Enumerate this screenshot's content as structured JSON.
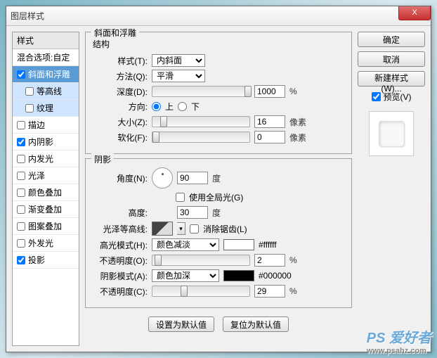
{
  "window": {
    "title": "图层样式",
    "close": "X"
  },
  "sidebar": {
    "header": "样式",
    "blend": "混合选项:自定",
    "items": [
      {
        "label": "斜面和浮雕",
        "checked": true,
        "sel": "blue"
      },
      {
        "label": "等高线",
        "checked": false,
        "sub": true,
        "sel": "light"
      },
      {
        "label": "纹理",
        "checked": false,
        "sub": true,
        "sel": "light"
      },
      {
        "label": "描边",
        "checked": false
      },
      {
        "label": "内阴影",
        "checked": true
      },
      {
        "label": "内发光",
        "checked": false
      },
      {
        "label": "光泽",
        "checked": false
      },
      {
        "label": "颜色叠加",
        "checked": false
      },
      {
        "label": "渐变叠加",
        "checked": false
      },
      {
        "label": "图案叠加",
        "checked": false
      },
      {
        "label": "外发光",
        "checked": false
      },
      {
        "label": "投影",
        "checked": true
      }
    ]
  },
  "panel": {
    "title": "斜面和浮雕",
    "structure": {
      "legend": "结构",
      "style": {
        "label": "样式(T):",
        "value": "内斜面"
      },
      "technique": {
        "label": "方法(Q):",
        "value": "平滑"
      },
      "depth": {
        "label": "深度(D):",
        "value": "1000",
        "unit": "%",
        "pos": 95
      },
      "direction": {
        "label": "方向:",
        "up": "上",
        "down": "下"
      },
      "size": {
        "label": "大小(Z):",
        "value": "16",
        "unit": "像素",
        "pos": 8
      },
      "soften": {
        "label": "软化(F):",
        "value": "0",
        "unit": "像素",
        "pos": 0
      }
    },
    "shading": {
      "legend": "阴影",
      "angle": {
        "label": "角度(N):",
        "value": "90",
        "unit": "度"
      },
      "global": "使用全局光(G)",
      "altitude": {
        "label": "高度:",
        "value": "30",
        "unit": "度"
      },
      "gloss": {
        "label": "光泽等高线:",
        "anti": "消除锯齿(L)"
      },
      "highlight_mode": {
        "label": "高光模式(H):",
        "value": "颜色减淡",
        "hex": "#ffffff"
      },
      "highlight_opacity": {
        "label": "不透明度(O):",
        "value": "2",
        "unit": "%",
        "pos": 2
      },
      "shadow_mode": {
        "label": "阴影模式(A):",
        "value": "颜色加深",
        "hex": "#000000"
      },
      "shadow_opacity": {
        "label": "不透明度(C):",
        "value": "29",
        "unit": "%",
        "pos": 29
      }
    },
    "buttons": {
      "default": "设置为默认值",
      "reset": "复位为默认值"
    }
  },
  "right": {
    "ok": "确定",
    "cancel": "取消",
    "newstyle": "新建样式(W)...",
    "preview": "预览(V)"
  },
  "watermark": {
    "main": "PS 爱好者",
    "sub": "www.psahz.com"
  }
}
